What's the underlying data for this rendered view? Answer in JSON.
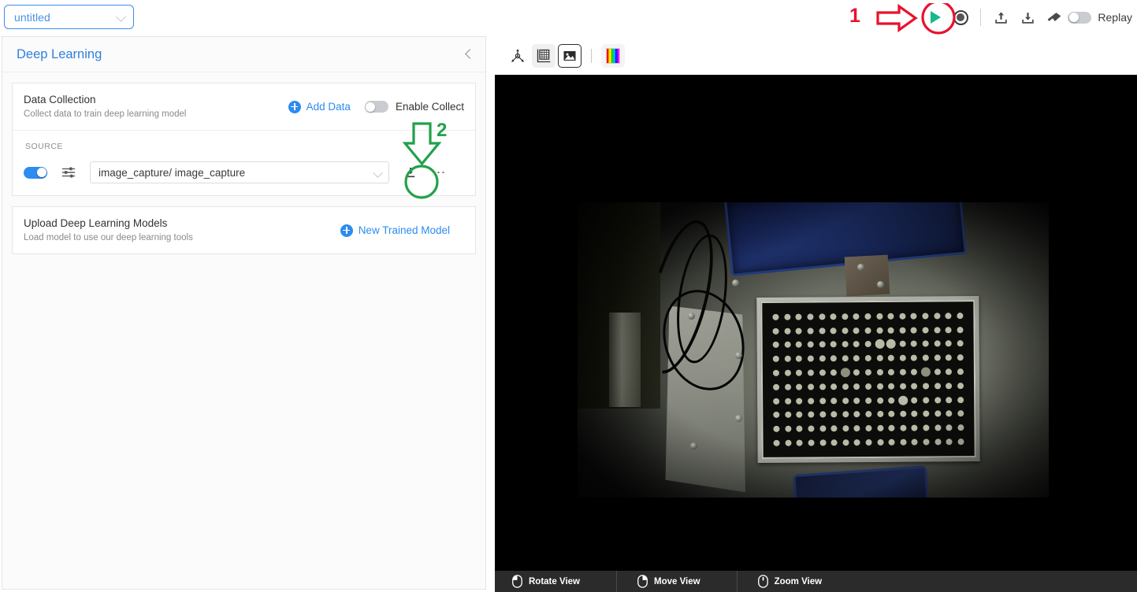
{
  "topbar": {
    "project_name": "untitled",
    "project_dropdown_icon": "chevron-down-icon",
    "play_icon": "play-icon",
    "record_icon": "record-icon",
    "upload_icon": "upload-icon",
    "download_icon": "download-icon",
    "eraser_icon": "eraser-icon",
    "replay_label": "Replay",
    "replay_toggle_state": "off"
  },
  "annotations": [
    {
      "id": "1",
      "label": "1",
      "color": "#e8112d",
      "shape": "right-arrow-with-circle",
      "target": "play-button"
    },
    {
      "id": "2",
      "label": "2",
      "color": "#21a14a",
      "shape": "down-arrow-with-circle",
      "target": "source-download-button"
    }
  ],
  "panel": {
    "title": "Deep Learning",
    "collapse_icon": "chevron-left-icon",
    "data_collection": {
      "title": "Data Collection",
      "subtitle": "Collect data to train deep learning model",
      "add_data_label": "Add Data",
      "add_data_icon": "plus-circle-icon",
      "enable_collect_label": "Enable Collect",
      "enable_collect_state": "off"
    },
    "source": {
      "section_label": "SOURCE",
      "enabled_toggle_state": "on",
      "settings_icon": "sliders-icon",
      "value": "image_capture/ image_capture",
      "dropdown_icon": "chevron-down-icon",
      "download_icon": "download-icon",
      "more_icon": "ellipsis-icon",
      "more_label": "⋯"
    },
    "upload_models": {
      "title": "Upload Deep Learning Models",
      "subtitle": "Load model to use our deep learning tools",
      "new_model_label": "New Trained Model",
      "new_model_icon": "plus-circle-icon"
    }
  },
  "viewer": {
    "toolbar": [
      {
        "name": "origin-axes-icon",
        "label": "origin",
        "state": "normal"
      },
      {
        "name": "grid-icon",
        "label": "grid",
        "state": "soft"
      },
      {
        "name": "image-icon",
        "label": "image",
        "state": "active"
      },
      {
        "name": "colorbar-icon",
        "label": "colormap",
        "state": "chip"
      }
    ],
    "scene_description": "Camera image of a dot-grid calibration target on an industrial workbench",
    "status_bar": [
      {
        "icon": "mouse-left-button-icon",
        "label": "Rotate View"
      },
      {
        "icon": "mouse-right-button-icon",
        "label": "Move View"
      },
      {
        "icon": "mouse-wheel-icon",
        "label": "Zoom View"
      }
    ]
  },
  "colors": {
    "accent_blue": "#2d8cf0",
    "title_blue": "#2e7fe0",
    "play_green": "#16b98e",
    "anno_red": "#e8112d",
    "anno_green": "#21a14a",
    "status_dark": "#2b2b2b"
  }
}
